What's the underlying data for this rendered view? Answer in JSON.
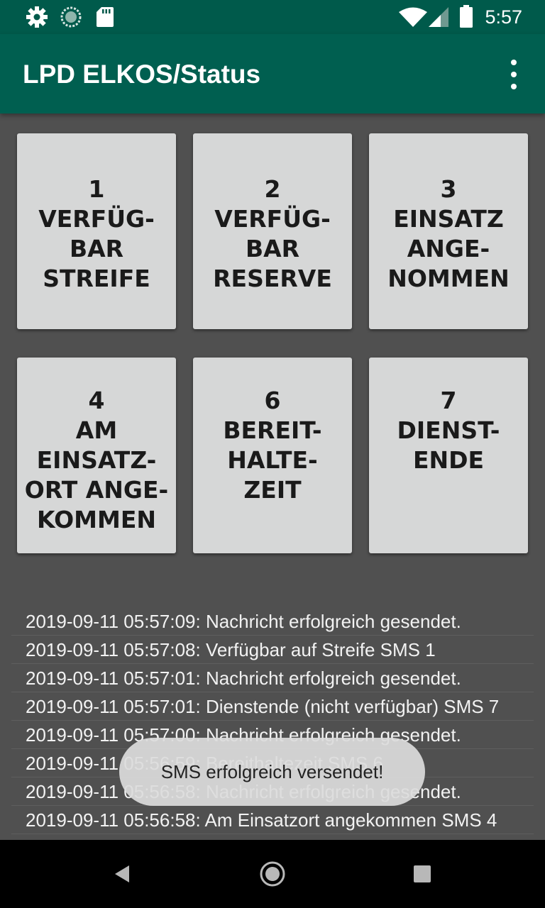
{
  "status_bar": {
    "time": "5:57",
    "icons": [
      "gear-icon",
      "sync-icon",
      "sd-card-icon",
      "wifi-icon",
      "cell-signal-icon",
      "battery-icon"
    ]
  },
  "app_bar": {
    "title": "LPD ELKOS/Status",
    "overflow_icon": "more-vert-icon"
  },
  "tiles": [
    {
      "lines": [
        "1",
        "VERFÜG-",
        "BAR",
        "STREIFE"
      ]
    },
    {
      "lines": [
        "2",
        "VERFÜG-",
        "BAR",
        "RESERVE"
      ]
    },
    {
      "lines": [
        "3",
        "EINSATZ",
        "ANGE-",
        "NOMMEN"
      ]
    },
    {
      "lines": [
        "4",
        "AM",
        "EINSATZ-",
        "ORT ANGE-",
        "KOMMEN"
      ]
    },
    {
      "lines": [
        "6",
        "BEREIT-",
        "HALTE-",
        "ZEIT"
      ]
    },
    {
      "lines": [
        "7",
        "DIENST-",
        "ENDE"
      ]
    }
  ],
  "log": [
    "2019-09-11 05:57:09: Nachricht erfolgreich gesendet.",
    "2019-09-11 05:57:08: Verfügbar auf Streife SMS 1",
    "2019-09-11 05:57:01: Nachricht erfolgreich gesendet.",
    "2019-09-11 05:57:01: Dienstende (nicht verfügbar) SMS 7",
    "2019-09-11 05:57:00: Nachricht erfolgreich gesendet.",
    "2019-09-11 05:56:59: Bereithaltezeit SMS 6",
    "2019-09-11 05:56:58: Nachricht erfolgreich gesendet.",
    "2019-09-11 05:56:58: Am Einsatzort angekommen SMS 4"
  ],
  "toast": "SMS erfolgreich versendet!",
  "nav": [
    "back-icon",
    "home-icon",
    "recents-icon"
  ],
  "colors": {
    "status_bar": "#005a4b",
    "app_bar": "#005f50",
    "background": "#505050",
    "tile": "#d6d7d7"
  }
}
